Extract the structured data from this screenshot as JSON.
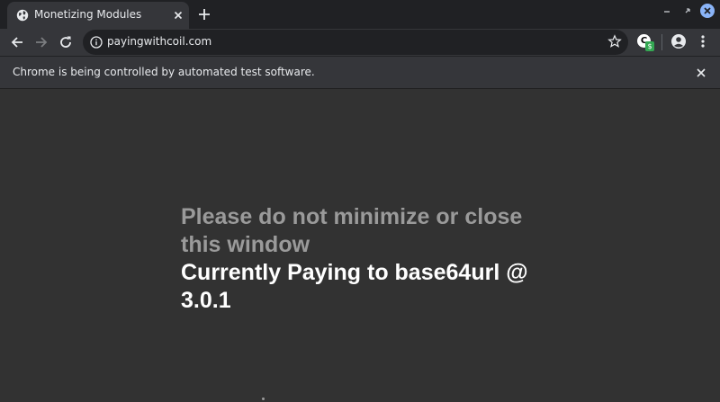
{
  "tab": {
    "title": "Monetizing Modules",
    "favicon": "globe-icon"
  },
  "toolbar": {
    "url": "payingwithcoil.com"
  },
  "extension": {
    "letter": "C",
    "badge": "$"
  },
  "infobar": {
    "text": "Chrome is being controlled by automated test software."
  },
  "page": {
    "line1": "Please do not minimize or close this window",
    "line2": "Currently Paying to base64url @ 3.0.1"
  },
  "colors": {
    "background": "#323232",
    "muted_text": "#9a9a9a",
    "bright_text": "#ffffff",
    "accent": "#8ab4f8"
  }
}
